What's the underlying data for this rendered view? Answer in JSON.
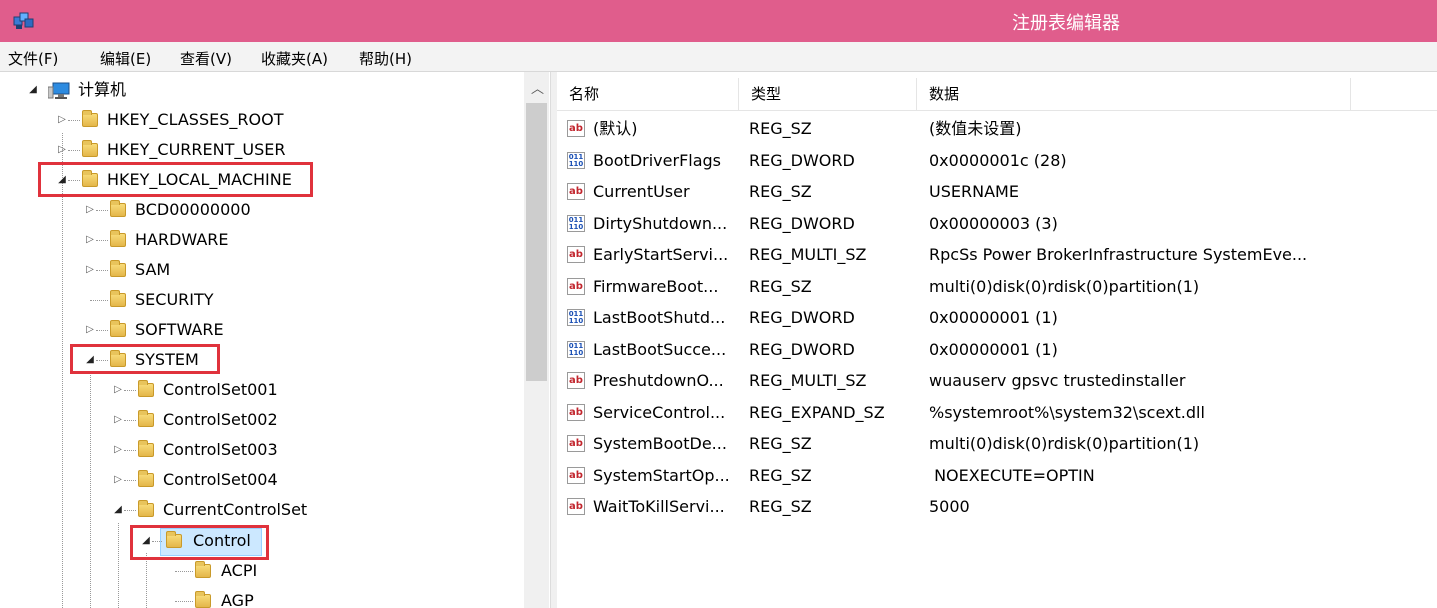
{
  "window": {
    "title": "注册表编辑器",
    "icon": "regedit-icon"
  },
  "menu": [
    "文件(F)",
    "编辑(E)",
    "查看(V)",
    "收藏夹(A)",
    "帮助(H)"
  ],
  "tree": {
    "root": "计算机",
    "nodes": [
      {
        "label": "HKEY_CLASSES_ROOT"
      },
      {
        "label": "HKEY_CURRENT_USER"
      },
      {
        "label": "HKEY_LOCAL_MACHINE"
      },
      {
        "label": "BCD00000000"
      },
      {
        "label": "HARDWARE"
      },
      {
        "label": "SAM"
      },
      {
        "label": "SECURITY"
      },
      {
        "label": "SOFTWARE"
      },
      {
        "label": "SYSTEM"
      },
      {
        "label": "ControlSet001"
      },
      {
        "label": "ControlSet002"
      },
      {
        "label": "ControlSet003"
      },
      {
        "label": "ControlSet004"
      },
      {
        "label": "CurrentControlSet"
      },
      {
        "label": "Control"
      },
      {
        "label": "ACPI"
      },
      {
        "label": "AGP"
      }
    ]
  },
  "list": {
    "columns": [
      "名称",
      "类型",
      "数据"
    ],
    "rows": [
      {
        "icon": "ab",
        "name": "(默认)",
        "type": "REG_SZ",
        "data": "(数值未设置)"
      },
      {
        "icon": "bin",
        "name": "BootDriverFlags",
        "type": "REG_DWORD",
        "data": "0x0000001c (28)"
      },
      {
        "icon": "ab",
        "name": "CurrentUser",
        "type": "REG_SZ",
        "data": "USERNAME"
      },
      {
        "icon": "bin",
        "name": "DirtyShutdown...",
        "type": "REG_DWORD",
        "data": "0x00000003 (3)"
      },
      {
        "icon": "ab",
        "name": "EarlyStartServi...",
        "type": "REG_MULTI_SZ",
        "data": "RpcSs Power BrokerInfrastructure SystemEve..."
      },
      {
        "icon": "ab",
        "name": "FirmwareBoot...",
        "type": "REG_SZ",
        "data": "multi(0)disk(0)rdisk(0)partition(1)"
      },
      {
        "icon": "bin",
        "name": "LastBootShutd...",
        "type": "REG_DWORD",
        "data": "0x00000001 (1)"
      },
      {
        "icon": "bin",
        "name": "LastBootSucce...",
        "type": "REG_DWORD",
        "data": "0x00000001 (1)"
      },
      {
        "icon": "ab",
        "name": "PreshutdownO...",
        "type": "REG_MULTI_SZ",
        "data": "wuauserv gpsvc trustedinstaller"
      },
      {
        "icon": "ab",
        "name": "ServiceControl...",
        "type": "REG_EXPAND_SZ",
        "data": "%systemroot%\\system32\\scext.dll"
      },
      {
        "icon": "ab",
        "name": "SystemBootDe...",
        "type": "REG_SZ",
        "data": "multi(0)disk(0)rdisk(0)partition(1)"
      },
      {
        "icon": "ab",
        "name": "SystemStartOp...",
        "type": "REG_SZ",
        "data": " NOEXECUTE=OPTIN"
      },
      {
        "icon": "ab",
        "name": "WaitToKillServi...",
        "type": "REG_SZ",
        "data": "5000"
      }
    ]
  },
  "colors": {
    "titlebar": "#e05d8c",
    "highlight_box": "#e0323c",
    "selection": "#cce8ff"
  }
}
